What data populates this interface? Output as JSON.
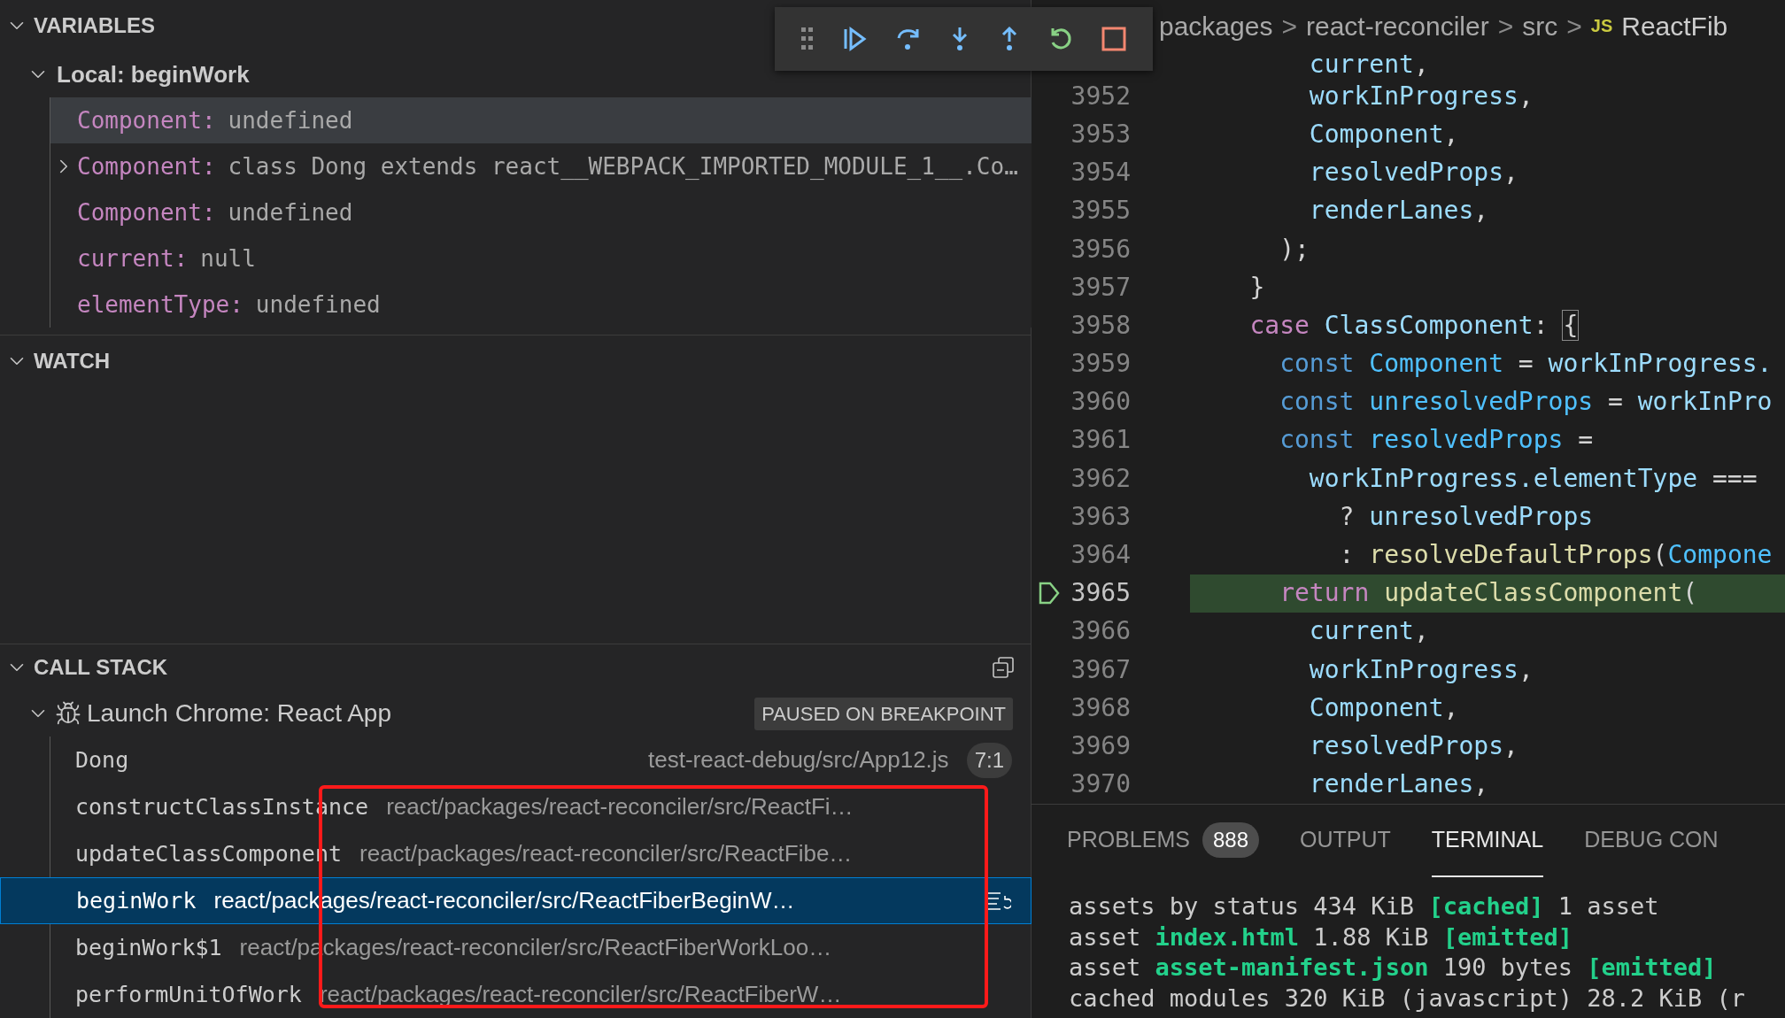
{
  "variables": {
    "title": "VARIABLES",
    "expanded": true,
    "scope": {
      "label": "Local: beginWork",
      "expanded": true
    },
    "items": [
      {
        "name": "Component:",
        "value": "undefined",
        "expandable": false,
        "highlighted": true
      },
      {
        "name": "Component:",
        "value": "class Dong extends react__WEBPACK_IMPORTED_MODULE_1__.Co…",
        "expandable": true,
        "highlighted": false
      },
      {
        "name": "Component:",
        "value": "undefined",
        "expandable": false,
        "highlighted": false
      },
      {
        "name": "current:",
        "value": "null",
        "expandable": false,
        "highlighted": false
      },
      {
        "name": "elementType:",
        "value": "undefined",
        "expandable": false,
        "highlighted": false
      }
    ]
  },
  "watch": {
    "title": "WATCH",
    "expanded": true
  },
  "call_stack": {
    "title": "CALL STACK",
    "expanded": true,
    "session": {
      "label": "Launch Chrome: React App",
      "status": "PAUSED ON BREAKPOINT",
      "expanded": true
    },
    "frames": [
      {
        "name": "Dong",
        "path": "test-react-debug/src/App12.js",
        "position": "7:1",
        "selected": false
      },
      {
        "name": "constructClassInstance",
        "path": "react/packages/react-reconciler/src/ReactFi…",
        "selected": false
      },
      {
        "name": "updateClassComponent",
        "path": "react/packages/react-reconciler/src/ReactFibe…",
        "selected": false
      },
      {
        "name": "beginWork",
        "path": "react/packages/react-reconciler/src/ReactFiberBeginW…",
        "selected": true
      },
      {
        "name": "beginWork$1",
        "path": "react/packages/react-reconciler/src/ReactFiberWorkLoo…",
        "selected": false
      },
      {
        "name": "performUnitOfWork",
        "path": "react/packages/react-reconciler/src/ReactFiberW…",
        "selected": false
      }
    ]
  },
  "debug_toolbar": {
    "buttons": [
      {
        "kind": "grip"
      },
      {
        "kind": "continue"
      },
      {
        "kind": "step-over"
      },
      {
        "kind": "step-into"
      },
      {
        "kind": "step-out"
      },
      {
        "kind": "restart"
      },
      {
        "kind": "stop"
      }
    ]
  },
  "breadcrumb": {
    "segments": [
      "packages",
      "react-reconciler",
      "src"
    ],
    "separator": ">",
    "file_badge": "JS",
    "file": "ReactFib"
  },
  "editor": {
    "lines": [
      {
        "tokens": [
          {
            "text": "        current",
            "kind": "var"
          },
          {
            "text": ",",
            "kind": "punct"
          }
        ],
        "breakpoint": false,
        "current": false
      },
      {
        "number": "3952",
        "tokens": [
          {
            "text": "        workInProgress",
            "kind": "var"
          },
          {
            "text": ",",
            "kind": "punct"
          }
        ],
        "breakpoint": false,
        "current": false
      },
      {
        "number": "3953",
        "tokens": [
          {
            "text": "        Component",
            "kind": "var"
          },
          {
            "text": ",",
            "kind": "punct"
          }
        ],
        "breakpoint": false,
        "current": false
      },
      {
        "number": "3954",
        "tokens": [
          {
            "text": "        resolvedProps",
            "kind": "var"
          },
          {
            "text": ",",
            "kind": "punct"
          }
        ],
        "breakpoint": false,
        "current": false
      },
      {
        "number": "3955",
        "tokens": [
          {
            "text": "        renderLanes",
            "kind": "var"
          },
          {
            "text": ",",
            "kind": "punct"
          }
        ],
        "breakpoint": false,
        "current": false
      },
      {
        "number": "3956",
        "tokens": [
          {
            "text": "      );",
            "kind": "punct"
          }
        ],
        "breakpoint": false,
        "current": false
      },
      {
        "number": "3957",
        "tokens": [
          {
            "text": "    }",
            "kind": "punct"
          }
        ],
        "breakpoint": false,
        "current": false
      },
      {
        "number": "3958",
        "tokens": [
          {
            "text": "    case",
            "kind": "control"
          },
          {
            "text": " ClassComponent",
            "kind": "var"
          },
          {
            "text": ": ",
            "kind": "punct"
          },
          {
            "text": "{",
            "kind": "bracket"
          }
        ],
        "breakpoint": false,
        "current": false
      },
      {
        "number": "3959",
        "tokens": [
          {
            "text": "      const",
            "kind": "keyword"
          },
          {
            "text": " Component",
            "kind": "const"
          },
          {
            "text": " = ",
            "kind": "punct"
          },
          {
            "text": "workInProgress.",
            "kind": "var"
          }
        ],
        "breakpoint": false,
        "current": false
      },
      {
        "number": "3960",
        "tokens": [
          {
            "text": "      const",
            "kind": "keyword"
          },
          {
            "text": " unresolvedProps",
            "kind": "const"
          },
          {
            "text": " = ",
            "kind": "punct"
          },
          {
            "text": "workInPro",
            "kind": "var"
          }
        ],
        "breakpoint": false,
        "current": false
      },
      {
        "number": "3961",
        "tokens": [
          {
            "text": "      const",
            "kind": "keyword"
          },
          {
            "text": " resolvedProps",
            "kind": "const"
          },
          {
            "text": " =",
            "kind": "punct"
          }
        ],
        "breakpoint": false,
        "current": false
      },
      {
        "number": "3962",
        "tokens": [
          {
            "text": "        workInProgress.elementType",
            "kind": "var"
          },
          {
            "text": " ===",
            "kind": "punct"
          }
        ],
        "breakpoint": false,
        "current": false
      },
      {
        "number": "3963",
        "tokens": [
          {
            "text": "          ? ",
            "kind": "punct"
          },
          {
            "text": "unresolvedProps",
            "kind": "var"
          }
        ],
        "breakpoint": false,
        "current": false
      },
      {
        "number": "3964",
        "tokens": [
          {
            "text": "          : ",
            "kind": "punct"
          },
          {
            "text": "resolveDefaultProps",
            "kind": "func"
          },
          {
            "text": "(",
            "kind": "punct"
          },
          {
            "text": "Compone",
            "kind": "const"
          }
        ],
        "breakpoint": false,
        "current": false
      },
      {
        "number": "3965",
        "tokens": [
          {
            "text": "      return",
            "kind": "control"
          },
          {
            "text": " updateClassComponent",
            "kind": "func"
          },
          {
            "text": "(",
            "kind": "punct"
          }
        ],
        "breakpoint": true,
        "current": true
      },
      {
        "number": "3966",
        "tokens": [
          {
            "text": "        current",
            "kind": "var"
          },
          {
            "text": ",",
            "kind": "punct"
          }
        ],
        "breakpoint": false,
        "current": false
      },
      {
        "number": "3967",
        "tokens": [
          {
            "text": "        workInProgress",
            "kind": "var"
          },
          {
            "text": ",",
            "kind": "punct"
          }
        ],
        "breakpoint": false,
        "current": false
      },
      {
        "number": "3968",
        "tokens": [
          {
            "text": "        Component",
            "kind": "var"
          },
          {
            "text": ",",
            "kind": "punct"
          }
        ],
        "breakpoint": false,
        "current": false
      },
      {
        "number": "3969",
        "tokens": [
          {
            "text": "        resolvedProps",
            "kind": "var"
          },
          {
            "text": ",",
            "kind": "punct"
          }
        ],
        "breakpoint": false,
        "current": false
      },
      {
        "number": "3970",
        "tokens": [
          {
            "text": "        renderLanes",
            "kind": "var"
          },
          {
            "text": ",",
            "kind": "punct"
          }
        ],
        "breakpoint": false,
        "current": false
      }
    ]
  },
  "panel": {
    "tabs": [
      {
        "label": "PROBLEMS",
        "badge": "888",
        "selected": false
      },
      {
        "label": "OUTPUT",
        "selected": false
      },
      {
        "label": "TERMINAL",
        "selected": true
      },
      {
        "label": "DEBUG CON",
        "selected": false
      }
    ],
    "terminal_lines": [
      [
        {
          "text": "assets by status 434 KiB ",
          "kind": "plain"
        },
        {
          "text": "[cached]",
          "kind": "green"
        },
        {
          "text": " 1 asset",
          "kind": "plain"
        }
      ],
      [
        {
          "text": "asset ",
          "kind": "plain"
        },
        {
          "text": "index.html",
          "kind": "green"
        },
        {
          "text": " 1.88 KiB ",
          "kind": "plain"
        },
        {
          "text": "[emitted]",
          "kind": "green"
        }
      ],
      [
        {
          "text": "asset ",
          "kind": "plain"
        },
        {
          "text": "asset-manifest.json",
          "kind": "green"
        },
        {
          "text": " 190 bytes ",
          "kind": "plain"
        },
        {
          "text": "[emitted]",
          "kind": "green"
        }
      ],
      [
        {
          "text": "cached modules 320 KiB (javascript) 28.2 KiB (r",
          "kind": "plain"
        }
      ]
    ]
  }
}
